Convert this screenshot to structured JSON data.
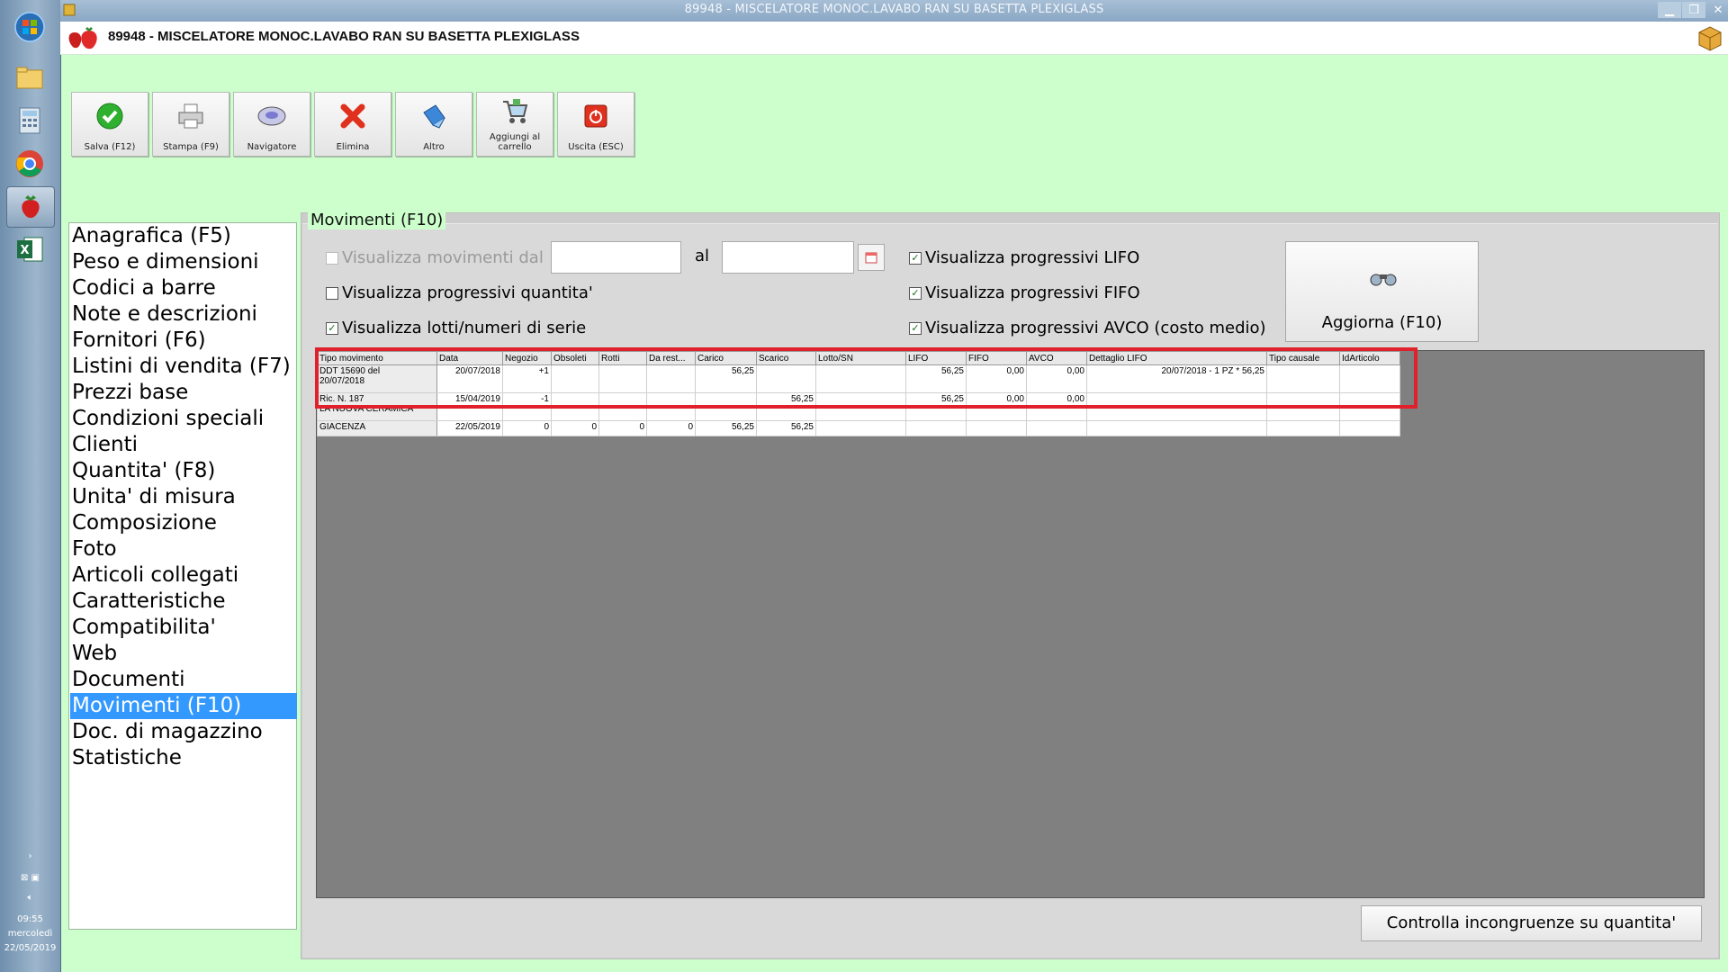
{
  "window": {
    "title": "89948 - MISCELATORE MONOC.LAVABO RAN SU BASETTA PLEXIGLASS",
    "app_title": "89948 - MISCELATORE MONOC.LAVABO RAN SU BASETTA PLEXIGLASS"
  },
  "taskbar": {
    "time": "09:55",
    "day": "mercoledì",
    "date": "22/05/2019"
  },
  "toolbar": [
    {
      "label": "Salva (F12)",
      "icon": "checkmark-icon"
    },
    {
      "label": "Stampa (F9)",
      "icon": "printer-icon"
    },
    {
      "label": "Navigatore",
      "icon": "navigator-icon"
    },
    {
      "label": "Elimina",
      "icon": "delete-x-icon"
    },
    {
      "label": "Altro",
      "icon": "altro-icon"
    },
    {
      "label": "Aggiungi al carrello",
      "icon": "cart-icon"
    },
    {
      "label": "Uscita (ESC)",
      "icon": "exit-icon"
    }
  ],
  "nav": {
    "items": [
      "Anagrafica (F5)",
      "Peso e dimensioni",
      "Codici a barre",
      "Note e descrizioni",
      "Fornitori (F6)",
      "Listini di vendita (F7)",
      "Prezzi base",
      "Condizioni speciali",
      "Clienti",
      "Quantita' (F8)",
      "Unita' di misura",
      "Composizione",
      "Foto",
      "Articoli collegati",
      "Caratteristiche",
      "Compatibilita'",
      "Web",
      "Documenti",
      "Movimenti (F10)",
      "Doc. di magazzino",
      "Statistiche"
    ],
    "selected": "Movimenti (F10)"
  },
  "movimenti": {
    "title": "Movimenti (F10)",
    "opt_dal": "Visualizza movimenti dal",
    "al": "al",
    "opt_quantita": "Visualizza progressivi quantita'",
    "opt_lotti": "Visualizza lotti/numeri di serie",
    "opt_lifo": "Visualizza progressivi LIFO",
    "opt_fifo": "Visualizza progressivi FIFO",
    "opt_avco": "Visualizza progressivi AVCO (costo medio)",
    "aggiorna": "Aggiorna (F10)",
    "controlla": "Controlla incongruenze su quantita'"
  },
  "grid": {
    "columns": [
      "Tipo movimento",
      "Data",
      "Negozio",
      "Obsoleti",
      "Rotti",
      "Da rest...",
      "Carico",
      "Scarico",
      "Lotto/SN",
      "LIFO",
      "FIFO",
      "AVCO",
      "Dettaglio LIFO",
      "Tipo causale",
      "IdArticolo"
    ],
    "rows": [
      {
        "tipo1": "DDT 15690 del",
        "tipo2": "20/07/2018",
        "data": "20/07/2018",
        "negozio": "+1",
        "obsoleti": "",
        "rotti": "",
        "darest": "",
        "carico": "56,25",
        "scarico": "",
        "lotto": "",
        "lifo": "56,25",
        "fifo": "0,00",
        "avco": "0,00",
        "dettaglio": "20/07/2018 - 1 PZ * 56,25",
        "causale": "",
        "id": ""
      },
      {
        "tipo1": "Ric. N. 187",
        "tipo2": "LA NUOVA CERAMICA",
        "data": "15/04/2019",
        "negozio": "-1",
        "obsoleti": "",
        "rotti": "",
        "darest": "",
        "carico": "",
        "scarico": "56,25",
        "lotto": "",
        "lifo": "56,25",
        "fifo": "0,00",
        "avco": "0,00",
        "dettaglio": "",
        "causale": "",
        "id": ""
      },
      {
        "tipo1": "GIACENZA",
        "tipo2": "",
        "data": "22/05/2019",
        "negozio": "0",
        "obsoleti": "0",
        "rotti": "0",
        "darest": "0",
        "carico": "56,25",
        "scarico": "56,25",
        "lotto": "",
        "lifo": "",
        "fifo": "",
        "avco": "",
        "dettaglio": "",
        "causale": "",
        "id": ""
      }
    ]
  }
}
